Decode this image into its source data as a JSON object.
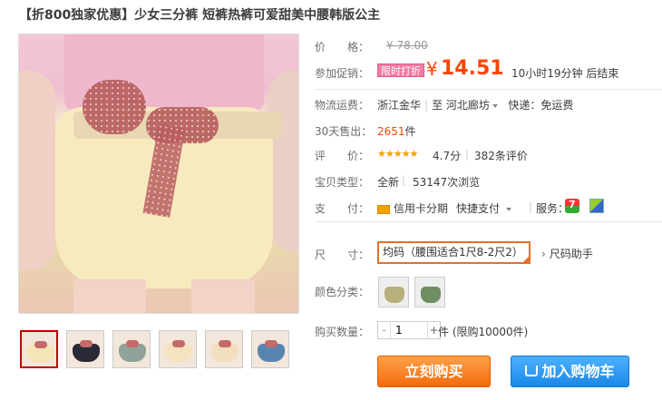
{
  "title": "【折800独家优惠】少女三分裤 短裤热裤可爱甜美中腰韩版公主",
  "price": {
    "label": "价　　格：",
    "original": "¥ 78.00"
  },
  "promo": {
    "label": "参加促销：",
    "tag": "限时打折",
    "currency": "¥",
    "price": "14.51",
    "countdown": "10小时19分钟 后结束"
  },
  "shipping": {
    "label": "物流运费：",
    "from": "浙江金华",
    "sep": "至",
    "to": "河北廊坊",
    "method": "快递：免运费"
  },
  "sales": {
    "label": "30天售出：",
    "count": "2651",
    "unit": "件"
  },
  "rating": {
    "label": "评　　价：",
    "stars": "★★★★★",
    "score": "4.7分",
    "reviews": "382条评价"
  },
  "item_type": {
    "label": "宝贝类型：",
    "condition": "全新",
    "views": "53147次浏览"
  },
  "payment": {
    "label": "支　　付：",
    "credit": "信用卡分期",
    "quick": "快捷支付",
    "service_label": "服务：",
    "seven": "7"
  },
  "size": {
    "label": "尺　　寸：",
    "selected": "均码（腰围适合1尺8-2尺2）",
    "helper": "尺码助手",
    "chevron": "›"
  },
  "color": {
    "label": "颜色分类："
  },
  "quantity": {
    "label": "购买数量：",
    "minus": "-",
    "value": "1",
    "plus": "+",
    "unit": "件 (限购10000件)"
  },
  "actions": {
    "buy_now": "立刻购买",
    "add_to_cart": "加入购物车"
  },
  "colors": {
    "accent": "#ff4400",
    "buy": "#f46a0c",
    "cart": "#1a88e8"
  }
}
